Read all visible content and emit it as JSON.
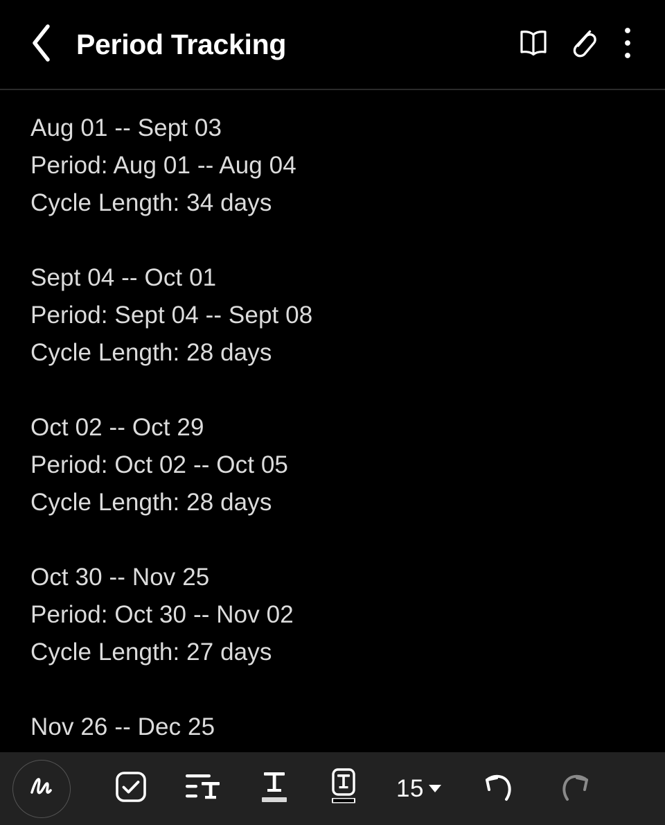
{
  "header": {
    "title": "Period Tracking",
    "back_icon": "chevron-left-icon",
    "actions": [
      {
        "name": "reading-mode",
        "icon": "book-icon"
      },
      {
        "name": "attachment",
        "icon": "paperclip-icon"
      },
      {
        "name": "more-options",
        "icon": "three-dot-menu-icon"
      }
    ]
  },
  "note": {
    "blocks": [
      {
        "range": "Aug 01 -- Sept 03",
        "period": "Period: Aug 01 -- Aug 04",
        "cycle": "Cycle Length: 34 days"
      },
      {
        "range": "Sept 04 -- Oct 01",
        "period": "Period: Sept 04 -- Sept 08",
        "cycle": "Cycle Length: 28 days"
      },
      {
        "range": "Oct 02 -- Oct 29",
        "period": "Period: Oct 02 -- Oct 05",
        "cycle": "Cycle Length: 28 days"
      },
      {
        "range": "Oct 30 -- Nov 25",
        "period": "Period: Oct 30 -- Nov 02",
        "cycle": "Cycle Length: 27 days"
      },
      {
        "range": "Nov 26 -- Dec 25",
        "period": "",
        "cycle": ""
      }
    ]
  },
  "toolbar": {
    "handwriting_icon": "handwriting-pen-icon",
    "checklist_icon": "checkbox-checked-icon",
    "paragraph_style_icon": "paragraph-text-style-icon",
    "text_color_icon": "text-underline-color-icon",
    "text_highlight_icon": "text-highlight-boxed-icon",
    "font_size": "15",
    "font_size_caret": "chevron-down-caret",
    "undo_icon": "undo-arrow-icon",
    "redo_icon": "redo-arrow-icon"
  },
  "colors": {
    "background": "#000000",
    "toolbar_background": "#222222",
    "title_text": "#ffffff",
    "body_text": "#dcdcdc",
    "icon_active": "#ffffff",
    "icon_disabled": "#8a8a8a",
    "divider": "#2b2b2b",
    "text_color_bar": "#d8d8d8",
    "text_highlight_bar": "#000000"
  }
}
